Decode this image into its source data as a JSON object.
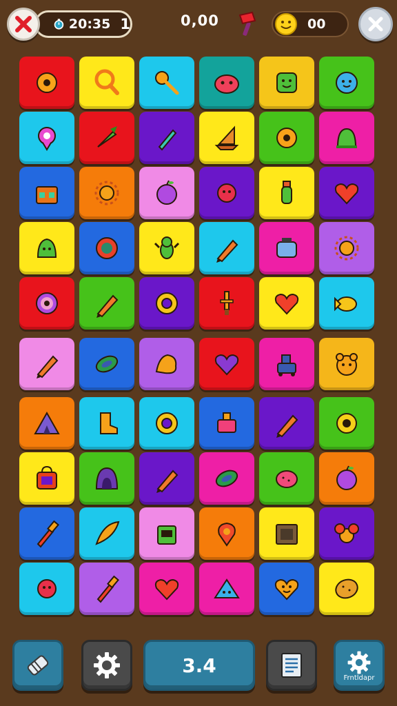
{
  "hud": {
    "timer": "20:35",
    "level": "1",
    "score": "0,00",
    "coins": "00"
  },
  "bottom": {
    "score_button": "3.4",
    "settings_label": "Frntldapr"
  },
  "colors": {
    "background": "#5a3a1e",
    "red": "#e8141c",
    "yellow": "#ffe81a",
    "cyan": "#1ec8ec",
    "teal": "#13a39b",
    "green": "#46c21a",
    "purple": "#6a17c9",
    "pink": "#f08ae6",
    "magenta": "#ee1fa6",
    "orange": "#f57c0a",
    "blue": "#2369e0",
    "lavender": "#b05ee8",
    "gold": "#f5b61a"
  },
  "grid": [
    [
      {
        "bg": "#e8141c",
        "icon": "gear-icon"
      },
      {
        "bg": "#ffe81a",
        "icon": "magnifier-icon"
      },
      {
        "bg": "#1ec8ec",
        "icon": "key-icon"
      },
      {
        "bg": "#13a39b",
        "icon": "blob-creature-icon"
      },
      {
        "bg": "#f5c51a",
        "icon": "smiley-block-icon"
      },
      {
        "bg": "#46c21a",
        "icon": "cloud-face-icon"
      }
    ],
    [
      {
        "bg": "#1ec8ec",
        "icon": "ring-icon"
      },
      {
        "bg": "#e8141c",
        "icon": "carrot-icon"
      },
      {
        "bg": "#6a17c9",
        "icon": "pen-icon"
      },
      {
        "bg": "#ffe81a",
        "icon": "ship-icon"
      },
      {
        "bg": "#46c21a",
        "icon": "gear-icon"
      },
      {
        "bg": "#ee1fa6",
        "icon": "slime-icon"
      }
    ],
    [
      {
        "bg": "#2369e0",
        "icon": "chest-icon"
      },
      {
        "bg": "#f57c0a",
        "icon": "sun-icon"
      },
      {
        "bg": "#f08ae6",
        "icon": "apple-icon"
      },
      {
        "bg": "#6a17c9",
        "icon": "spiky-blob-icon"
      },
      {
        "bg": "#ffe81a",
        "icon": "bottle-icon"
      },
      {
        "bg": "#6a17c9",
        "icon": "heart-icon"
      }
    ],
    [
      {
        "bg": "#ffe81a",
        "icon": "bell-icon"
      },
      {
        "bg": "#2369e0",
        "icon": "swirl-icon"
      },
      {
        "bg": "#ffe81a",
        "icon": "bug-icon"
      },
      {
        "bg": "#1ec8ec",
        "icon": "pencil-icon"
      },
      {
        "bg": "#ee1fa6",
        "icon": "jar-icon"
      },
      {
        "bg": "#b05ee8",
        "icon": "sun-icon"
      }
    ],
    [
      {
        "bg": "#e8141c",
        "icon": "target-icon"
      },
      {
        "bg": "#46c21a",
        "icon": "pencil-icon"
      },
      {
        "bg": "#6a17c9",
        "icon": "donut-icon"
      },
      {
        "bg": "#e8141c",
        "icon": "sword-icon"
      },
      {
        "bg": "#ffe81a",
        "icon": "heart-icon"
      },
      {
        "bg": "#1ec8ec",
        "icon": "fish-icon"
      }
    ],
    [
      {
        "bg": "#f08ae6",
        "icon": "pencil-icon"
      },
      {
        "bg": "#2369e0",
        "icon": "leaf-icon"
      },
      {
        "bg": "#b05ee8",
        "icon": "splat-icon"
      },
      {
        "bg": "#e8141c",
        "icon": "purple-heart-icon"
      },
      {
        "bg": "#ee1fa6",
        "icon": "robot-icon"
      },
      {
        "bg": "#f5b61a",
        "icon": "bear-face-icon"
      }
    ],
    [
      {
        "bg": "#f57c0a",
        "icon": "tent-icon"
      },
      {
        "bg": "#1ec8ec",
        "icon": "boot-icon"
      },
      {
        "bg": "#1ec8ec",
        "icon": "donut-icon"
      },
      {
        "bg": "#2369e0",
        "icon": "tube-icon"
      },
      {
        "bg": "#6a17c9",
        "icon": "pencil-icon"
      },
      {
        "bg": "#46c21a",
        "icon": "flower-icon"
      }
    ],
    [
      {
        "bg": "#ffe81a",
        "icon": "bag-icon"
      },
      {
        "bg": "#46c21a",
        "icon": "hood-icon"
      },
      {
        "bg": "#6a17c9",
        "icon": "pencil-icon"
      },
      {
        "bg": "#ee1fa6",
        "icon": "leaf-icon"
      },
      {
        "bg": "#46c21a",
        "icon": "berry-icon"
      },
      {
        "bg": "#f57c0a",
        "icon": "apple-icon"
      }
    ],
    [
      {
        "bg": "#2369e0",
        "icon": "brush-icon"
      },
      {
        "bg": "#1ec8ec",
        "icon": "feather-icon"
      },
      {
        "bg": "#f08ae6",
        "icon": "radio-icon"
      },
      {
        "bg": "#f57c0a",
        "icon": "pin-icon"
      },
      {
        "bg": "#ffe81a",
        "icon": "crate-icon"
      },
      {
        "bg": "#6a17c9",
        "icon": "mouse-icon"
      }
    ],
    [
      {
        "bg": "#1ec8ec",
        "icon": "spiky-blob-icon"
      },
      {
        "bg": "#b05ee8",
        "icon": "brush-icon"
      },
      {
        "bg": "#ee1fa6",
        "icon": "heart-icon"
      },
      {
        "bg": "#ee1fa6",
        "icon": "triangle-face-icon"
      },
      {
        "bg": "#2369e0",
        "icon": "heart-face-icon"
      },
      {
        "bg": "#ffe81a",
        "icon": "potato-icon"
      }
    ]
  ]
}
